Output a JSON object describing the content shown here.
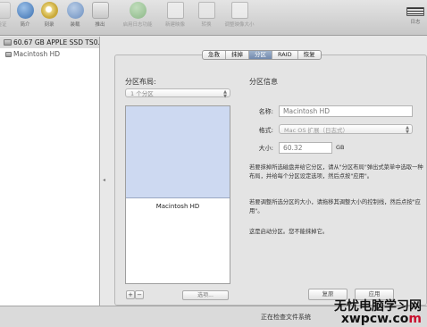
{
  "toolbar": {
    "items": [
      {
        "label": "验证",
        "icon": "verify-icon"
      },
      {
        "label": "简介",
        "icon": "info-icon"
      },
      {
        "label": "刻录",
        "icon": "burn-icon"
      },
      {
        "label": "装载",
        "icon": "mount-icon"
      },
      {
        "label": "推出",
        "icon": "eject-icon"
      },
      {
        "label": "启用日志功能",
        "icon": "journal-icon"
      },
      {
        "label": "新建映像",
        "icon": "new-image-icon"
      },
      {
        "label": "转换",
        "icon": "convert-icon"
      },
      {
        "label": "调整映像大小",
        "icon": "resize-image-icon"
      },
      {
        "label": "日志",
        "icon": "log-icon"
      }
    ]
  },
  "sidebar": {
    "disk": "60.67 GB APPLE SSD TS0...",
    "volume": "Macintosh HD"
  },
  "tabs": [
    "急救",
    "抹掉",
    "分区",
    "RAID",
    "恢复"
  ],
  "active_tab": "分区",
  "layout": {
    "title": "分区布局:",
    "select_value": "1 个分区",
    "partition_name": "Macintosh HD",
    "add_label": "+",
    "remove_label": "−",
    "options_label": "选项..."
  },
  "info": {
    "title": "分区信息",
    "name_label": "名称:",
    "name_value": "Macintosh HD",
    "format_label": "格式:",
    "format_value": "Mac OS 扩展（日志式）",
    "size_label": "大小:",
    "size_value": "60.32",
    "size_unit": "GB",
    "help1": "若要抹掉所选磁盘并给它分区，请从\"分区布局\"弹出式菜单中选取一种布局，并给每个分区设定选项，然后点按\"应用\"。",
    "help2": "若要调整所选分区的大小，请拖移其调整大小的控制线，然后点按\"应用\"。",
    "help3": "这是启动分区。您不能抹掉它。"
  },
  "buttons": {
    "revert": "复原",
    "apply": "应用"
  },
  "status": "正在检查文件系统",
  "watermark": {
    "line1": "无忧电脑学习网",
    "line2_a": "xwpcw.co",
    "line2_b": "m"
  },
  "colors": {
    "partition_fill": "#cdd9f1",
    "active_tab": "#7189ad"
  }
}
